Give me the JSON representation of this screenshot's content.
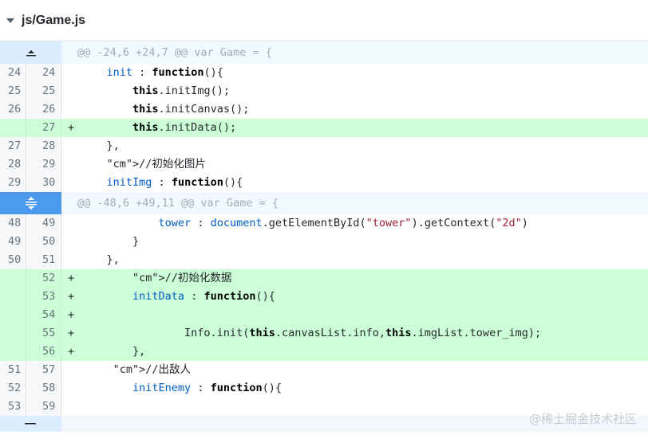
{
  "file": {
    "name": "js/Game.js"
  },
  "hunks": [
    {
      "header": "@@ -24,6 +24,7 @@ var Game = {",
      "expander_icon": "expand-up-icon"
    },
    {
      "header": "@@ -48,6 +49,11 @@ var Game = {",
      "expander_icon": "expand-both-icon"
    }
  ],
  "lines": [
    {
      "old": "24",
      "new": "24",
      "mark": "",
      "text": "    init : function(){"
    },
    {
      "old": "25",
      "new": "25",
      "mark": "",
      "text": "        this.initImg();"
    },
    {
      "old": "26",
      "new": "26",
      "mark": "",
      "text": "        this.initCanvas();"
    },
    {
      "old": "",
      "new": "27",
      "mark": "+",
      "text": "        this.initData();"
    },
    {
      "old": "27",
      "new": "28",
      "mark": "",
      "text": "    },"
    },
    {
      "old": "28",
      "new": "29",
      "mark": "",
      "text": "    //初始化图片"
    },
    {
      "old": "29",
      "new": "30",
      "mark": "",
      "text": "    initImg : function(){"
    },
    {
      "old": "48",
      "new": "49",
      "mark": "",
      "text": "            tower : document.getElementById(\"tower\").getContext(\"2d\")"
    },
    {
      "old": "49",
      "new": "50",
      "mark": "",
      "text": "        }"
    },
    {
      "old": "50",
      "new": "51",
      "mark": "",
      "text": "    },"
    },
    {
      "old": "",
      "new": "52",
      "mark": "+",
      "text": "        //初始化数据"
    },
    {
      "old": "",
      "new": "53",
      "mark": "+",
      "text": "        initData : function(){"
    },
    {
      "old": "",
      "new": "54",
      "mark": "+",
      "text": ""
    },
    {
      "old": "",
      "new": "55",
      "mark": "+",
      "text": "                Info.init(this.canvasList.info,this.imgList.tower_img);"
    },
    {
      "old": "",
      "new": "56",
      "mark": "+",
      "text": "        },"
    },
    {
      "old": "51",
      "new": "57",
      "mark": "",
      "text": "     //出敌人"
    },
    {
      "old": "52",
      "new": "58",
      "mark": "",
      "text": "        initEnemy : function(){"
    },
    {
      "old": "53",
      "new": "59",
      "mark": "",
      "text": ""
    }
  ],
  "watermark": "@稀土掘金技术社区",
  "colors": {
    "addition_bg": "#ccffd8",
    "hunk_bg": "#f1f8ff",
    "expander_active": "#4c9af0"
  }
}
